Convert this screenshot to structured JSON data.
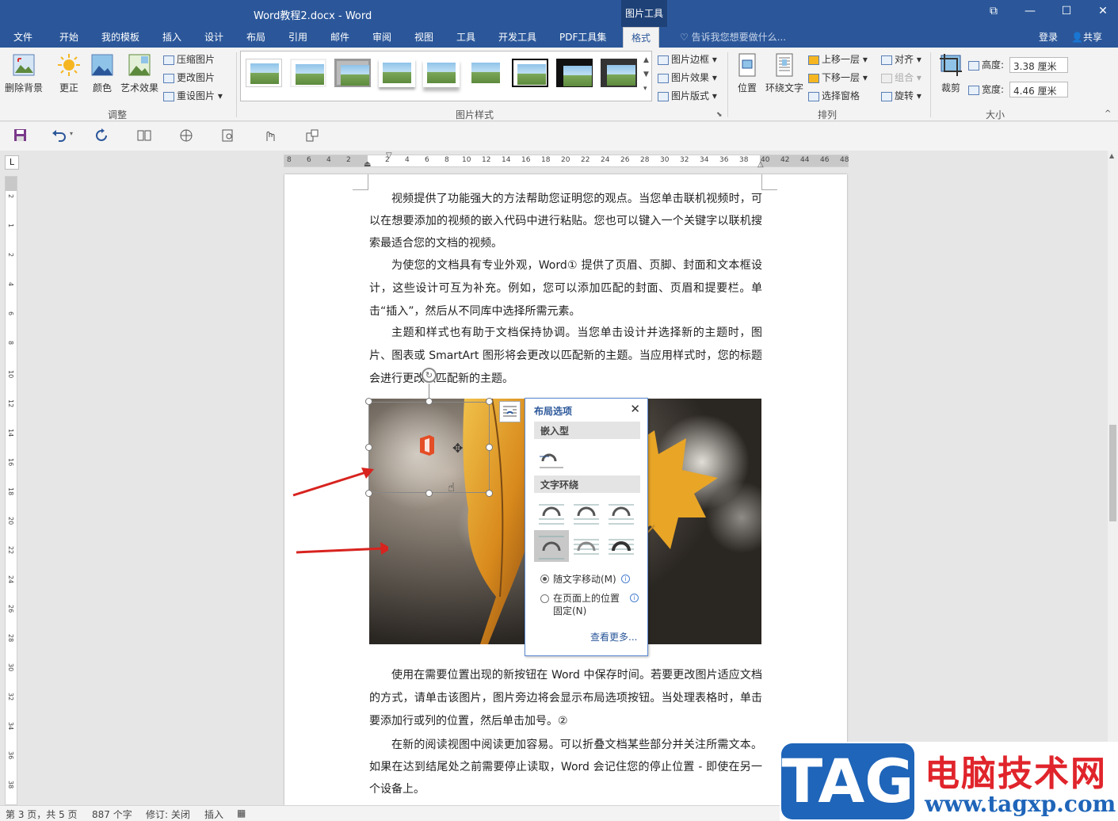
{
  "window": {
    "title": "Word教程2.docx - Word",
    "context_tab_header": "图片工具",
    "controls": [
      "ribbon-display",
      "minimize",
      "maximize",
      "close"
    ]
  },
  "tabs": {
    "file": "文件",
    "home": "开始",
    "templates": "我的模板",
    "insert": "插入",
    "design": "设计",
    "layout": "布局",
    "references": "引用",
    "mailings": "邮件",
    "review": "审阅",
    "view": "视图",
    "tools": "工具",
    "developer": "开发工具",
    "pdf": "PDF工具集",
    "format": "格式",
    "tell_me": "告诉我您想要做什么...",
    "signin": "登录",
    "share": "共享"
  },
  "ribbon": {
    "remove_bg": "删除背景",
    "corrections": "更正",
    "color": "颜色",
    "artistic": "艺术效果",
    "compress": "压缩图片",
    "change_pic": "更改图片",
    "reset_pic": "重设图片",
    "adjust_group": "调整",
    "styles_group": "图片样式",
    "pic_border": "图片边框",
    "pic_effects": "图片效果",
    "pic_layout": "图片版式",
    "position": "位置",
    "wrap_text": "环绕文字",
    "bring_forward": "上移一层",
    "send_backward": "下移一层",
    "selection_pane": "选择窗格",
    "align": "对齐",
    "group": "组合",
    "rotate": "旋转",
    "arrange_group": "排列",
    "crop": "裁剪",
    "height_label": "高度:",
    "height_value": "3.38 厘米",
    "width_label": "宽度:",
    "width_value": "4.46 厘米",
    "size_group": "大小"
  },
  "qat": [
    "save-icon",
    "undo-icon",
    "redo-icon",
    "read-mode-icon",
    "web-layout-icon",
    "print-preview-icon",
    "touch-mode-icon",
    "more-icon"
  ],
  "ruler": {
    "left_ticks": [
      "8",
      "6",
      "4",
      "2"
    ],
    "ticks": [
      "2",
      "4",
      "6",
      "8",
      "10",
      "12",
      "14",
      "16",
      "18",
      "20",
      "22",
      "24",
      "26",
      "28",
      "30",
      "32",
      "34",
      "36",
      "38"
    ],
    "right_ticks": [
      "40",
      "42",
      "44",
      "46",
      "48"
    ],
    "vertical": [
      "2",
      "1",
      "2",
      "4",
      "6",
      "8",
      "10",
      "12",
      "14",
      "16",
      "18",
      "20",
      "22",
      "24",
      "26",
      "28",
      "30",
      "32",
      "34",
      "36",
      "38"
    ]
  },
  "document": {
    "p1": "视频提供了功能强大的方法帮助您证明您的观点。当您单击联机视频时，可以在想要添加的视频的嵌入代码中进行粘贴。您也可以键入一个关键字以联机搜索最适合您的文档的视频。",
    "p2": "为使您的文档具有专业外观，Word① 提供了页眉、页脚、封面和文本框设计，这些设计可互为补充。例如，您可以添加匹配的封面、页眉和提要栏。单击“插入”，然后从不同库中选择所需元素。",
    "p3": "主题和样式也有助于文档保持协调。当您单击设计并选择新的主题时，图片、图表或 SmartArt 图形将会更改以匹配新的主题。当应用样式时，您的标题会进行更改以匹配新的主题。",
    "p4": "使用在需要位置出现的新按钮在 Word 中保存时间。若要更改图片适应文档的方式，请单击该图片，图片旁边将会显示布局选项按钮。当处理表格时，单击要添加行或列的位置，然后单击加号。②",
    "p5": "在新的阅读视图中阅读更加容易。可以折叠文档某些部分并关注所需文本。如果在达到结尾处之前需要停止读取，Word 会记住您的停止位置 - 即使在另一个设备上。"
  },
  "layout_popup": {
    "title": "布局选项",
    "inline_section": "嵌入型",
    "wrap_section": "文字环绕",
    "move_with_text": "随文字移动(M)",
    "fix_position_line1": "在页面上的位置",
    "fix_position_line2": "固定(N)",
    "see_more": "查看更多..."
  },
  "status": {
    "page": "第 3 页，共 5 页",
    "words": "887 个字",
    "track": "修订: 关闭",
    "mode": "插入"
  },
  "watermark": {
    "logo": "TAG",
    "title": "电脑技术网",
    "url": "www.tagxp.com"
  }
}
